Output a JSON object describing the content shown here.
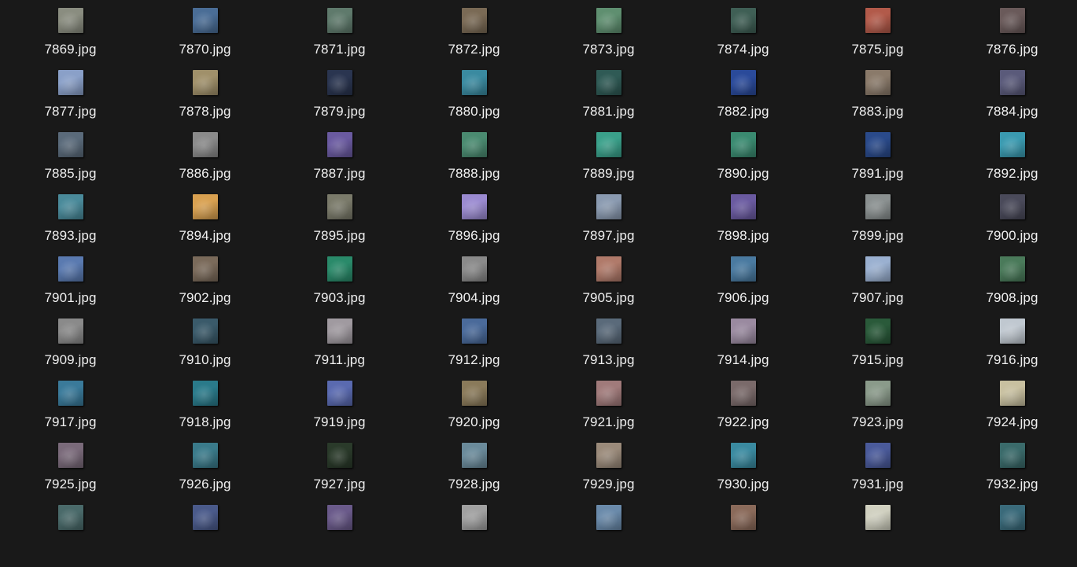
{
  "files": [
    {
      "name": "7869.jpg",
      "thumb": "#8a8d80"
    },
    {
      "name": "7870.jpg",
      "thumb": "#4a6d96"
    },
    {
      "name": "7871.jpg",
      "thumb": "#5f7a6c"
    },
    {
      "name": "7872.jpg",
      "thumb": "#7a6a55"
    },
    {
      "name": "7873.jpg",
      "thumb": "#5f8f70"
    },
    {
      "name": "7874.jpg",
      "thumb": "#3f5f55"
    },
    {
      "name": "7875.jpg",
      "thumb": "#b25a4a"
    },
    {
      "name": "7876.jpg",
      "thumb": "#6a5a5a"
    },
    {
      "name": "7877.jpg",
      "thumb": "#8aa0c8"
    },
    {
      "name": "7878.jpg",
      "thumb": "#a0906a"
    },
    {
      "name": "7879.jpg",
      "thumb": "#2a3550"
    },
    {
      "name": "7880.jpg",
      "thumb": "#3a8aa0"
    },
    {
      "name": "7881.jpg",
      "thumb": "#2f5a55"
    },
    {
      "name": "7882.jpg",
      "thumb": "#2a4a9a"
    },
    {
      "name": "7883.jpg",
      "thumb": "#8a7a6a"
    },
    {
      "name": "7884.jpg",
      "thumb": "#5a5a7a"
    },
    {
      "name": "7885.jpg",
      "thumb": "#5a6a7a"
    },
    {
      "name": "7886.jpg",
      "thumb": "#8a8a8a"
    },
    {
      "name": "7887.jpg",
      "thumb": "#6a5aa0"
    },
    {
      "name": "7888.jpg",
      "thumb": "#4a8a70"
    },
    {
      "name": "7889.jpg",
      "thumb": "#3aa08a"
    },
    {
      "name": "7890.jpg",
      "thumb": "#3a8a70"
    },
    {
      "name": "7891.jpg",
      "thumb": "#2a4a8a"
    },
    {
      "name": "7892.jpg",
      "thumb": "#3a9ab0"
    },
    {
      "name": "7893.jpg",
      "thumb": "#4a8a9a"
    },
    {
      "name": "7894.jpg",
      "thumb": "#d8a050"
    },
    {
      "name": "7895.jpg",
      "thumb": "#7a7a6a"
    },
    {
      "name": "7896.jpg",
      "thumb": "#9a8ad0"
    },
    {
      "name": "7897.jpg",
      "thumb": "#8a9ab0"
    },
    {
      "name": "7898.jpg",
      "thumb": "#6a5aa0"
    },
    {
      "name": "7899.jpg",
      "thumb": "#8a9090"
    },
    {
      "name": "7900.jpg",
      "thumb": "#4a4a5a"
    },
    {
      "name": "7901.jpg",
      "thumb": "#5a7ab0"
    },
    {
      "name": "7902.jpg",
      "thumb": "#7a6a5a"
    },
    {
      "name": "7903.jpg",
      "thumb": "#2a8a6a"
    },
    {
      "name": "7904.jpg",
      "thumb": "#8a8a8a"
    },
    {
      "name": "7905.jpg",
      "thumb": "#b07a6a"
    },
    {
      "name": "7906.jpg",
      "thumb": "#4a7aa0"
    },
    {
      "name": "7907.jpg",
      "thumb": "#9ab0d0"
    },
    {
      "name": "7908.jpg",
      "thumb": "#4a7a5a"
    },
    {
      "name": "7909.jpg",
      "thumb": "#8a8a8a"
    },
    {
      "name": "7910.jpg",
      "thumb": "#3a5a6a"
    },
    {
      "name": "7911.jpg",
      "thumb": "#a09aa0"
    },
    {
      "name": "7912.jpg",
      "thumb": "#4a6a9a"
    },
    {
      "name": "7913.jpg",
      "thumb": "#5a6a7a"
    },
    {
      "name": "7914.jpg",
      "thumb": "#9a8aa0"
    },
    {
      "name": "7915.jpg",
      "thumb": "#2a5a3a"
    },
    {
      "name": "7916.jpg",
      "thumb": "#c0c8d0"
    },
    {
      "name": "7917.jpg",
      "thumb": "#3a7a9a"
    },
    {
      "name": "7918.jpg",
      "thumb": "#2a7a8a"
    },
    {
      "name": "7919.jpg",
      "thumb": "#5a6ab0"
    },
    {
      "name": "7920.jpg",
      "thumb": "#8a7a5a"
    },
    {
      "name": "7921.jpg",
      "thumb": "#a07a7a"
    },
    {
      "name": "7922.jpg",
      "thumb": "#7a6a6a"
    },
    {
      "name": "7923.jpg",
      "thumb": "#8a9a8a"
    },
    {
      "name": "7924.jpg",
      "thumb": "#c8c0a0"
    },
    {
      "name": "7925.jpg",
      "thumb": "#7a6a7a"
    },
    {
      "name": "7926.jpg",
      "thumb": "#3a7a8a"
    },
    {
      "name": "7927.jpg",
      "thumb": "#2a3a2a"
    },
    {
      "name": "7928.jpg",
      "thumb": "#6a8a9a"
    },
    {
      "name": "7929.jpg",
      "thumb": "#9a8a7a"
    },
    {
      "name": "7930.jpg",
      "thumb": "#3a8aa0"
    },
    {
      "name": "7931.jpg",
      "thumb": "#4a5a9a"
    },
    {
      "name": "7932.jpg",
      "thumb": "#3a6a6a"
    },
    {
      "name": "",
      "thumb": "#4a6a6a"
    },
    {
      "name": "",
      "thumb": "#4a5a8a"
    },
    {
      "name": "",
      "thumb": "#6a5a8a"
    },
    {
      "name": "",
      "thumb": "#a0a0a0"
    },
    {
      "name": "",
      "thumb": "#6a8aaa"
    },
    {
      "name": "",
      "thumb": "#8a6a5a"
    },
    {
      "name": "",
      "thumb": "#d0d0c0"
    },
    {
      "name": "",
      "thumb": "#3a6a7a"
    }
  ]
}
